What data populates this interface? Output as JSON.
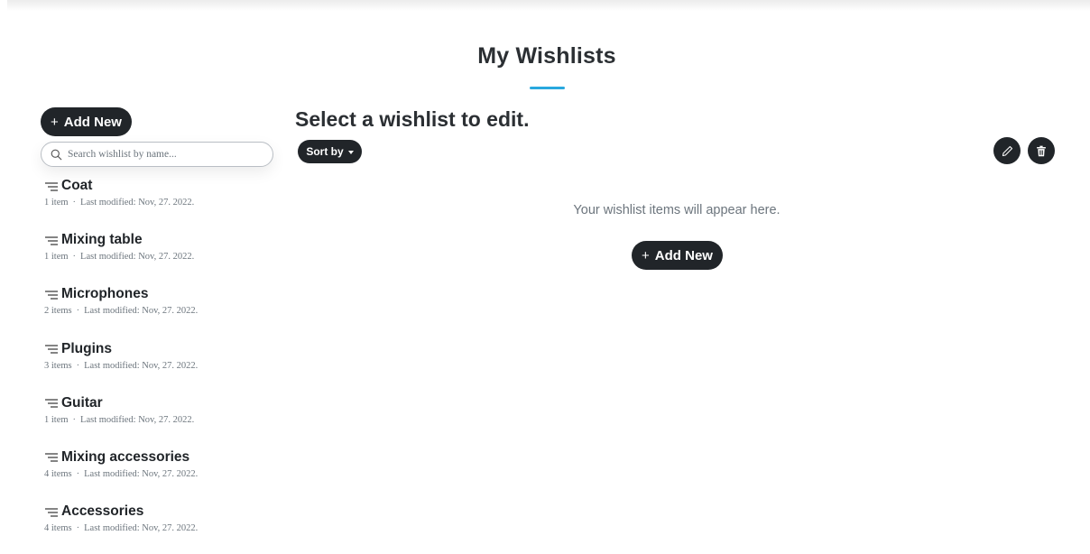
{
  "page": {
    "title": "My Wishlists",
    "accent_color": "#29a8de",
    "button_color": "#212529"
  },
  "sidebar": {
    "add_new_label": "Add New",
    "add_new_icon": "plus-icon",
    "search": {
      "placeholder": "Search wishlist by name...",
      "value": "",
      "icon": "search-icon"
    },
    "wishlists": [
      {
        "name": "Coat",
        "count": "1 item",
        "modified": "Last modified: Nov, 27. 2022."
      },
      {
        "name": "Mixing table",
        "count": "1 item",
        "modified": "Last modified: Nov, 27. 2022."
      },
      {
        "name": "Microphones",
        "count": "2 items",
        "modified": "Last modified: Nov, 27. 2022."
      },
      {
        "name": "Plugins",
        "count": "3 items",
        "modified": "Last modified: Nov, 27. 2022."
      },
      {
        "name": "Guitar",
        "count": "1 item",
        "modified": "Last modified: Nov, 27. 2022."
      },
      {
        "name": "Mixing accessories",
        "count": "4 items",
        "modified": "Last modified: Nov, 27. 2022."
      },
      {
        "name": "Accessories",
        "count": "4 items",
        "modified": "Last modified: Nov, 27. 2022."
      }
    ],
    "separator": "·"
  },
  "main": {
    "heading": "Select a wishlist to edit.",
    "sort_label": "Sort by",
    "edit_icon": "pencil-icon",
    "delete_icon": "trash-icon",
    "empty_message": "Your wishlist items will appear here.",
    "add_new_label": "Add New"
  }
}
